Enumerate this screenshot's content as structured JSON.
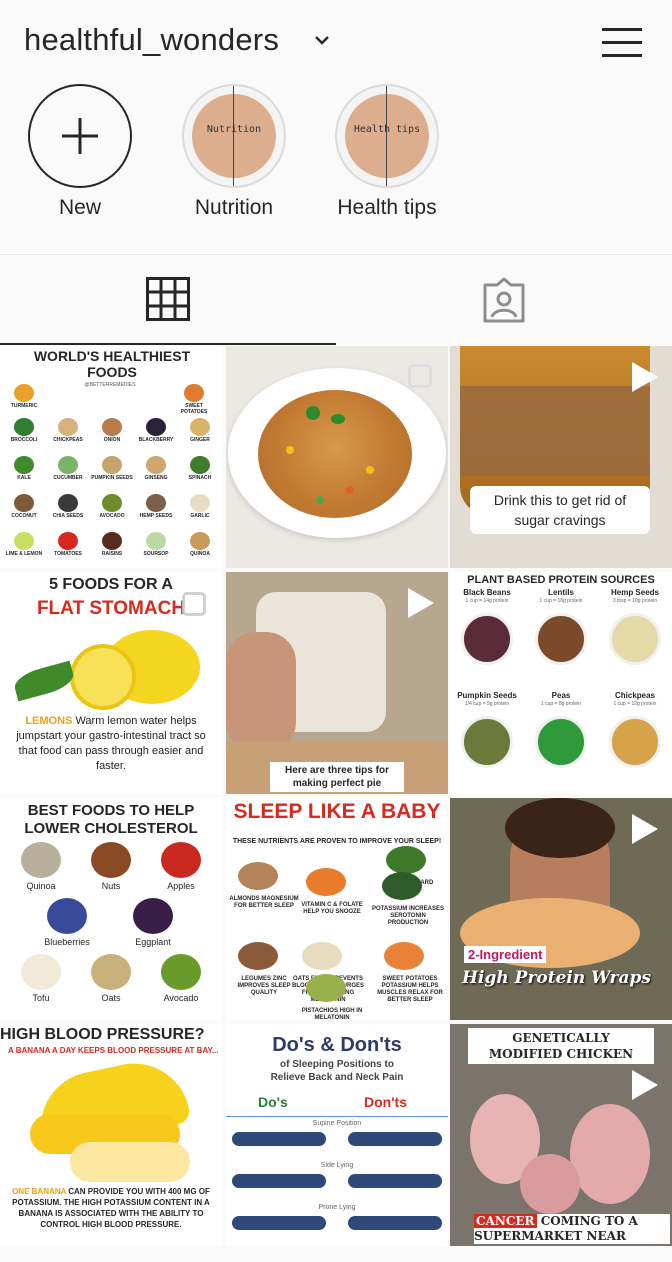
{
  "header": {
    "username": "healthful_wonders"
  },
  "highlights": [
    {
      "label": "New"
    },
    {
      "label": "Nutrition",
      "cover_text": "Nutrition"
    },
    {
      "label": "Health tips",
      "cover_text": "Health tips"
    }
  ],
  "tabs": [
    {
      "icon": "grid-icon"
    },
    {
      "icon": "tagged-icon"
    }
  ],
  "posts": {
    "p1": {
      "title": "WORLD'S HEALTHIEST FOODS",
      "handle": "@BETTERREMEDIES",
      "foods": [
        "TURMERIC",
        "SWEET POTATOES",
        "BROCCOLI",
        "CHICKPEAS",
        "ONION",
        "BLACKBERRY",
        "GINGER",
        "KALE",
        "CUCUMBER",
        "PUMPKIN SEEDS",
        "GINSENG",
        "SPINACH",
        "COCONUT",
        "CHIA SEEDS",
        "AVOCADO",
        "HEMP SEEDS",
        "GARLIC",
        "LIME & LEMON",
        "TOMATOES",
        "RAISINS",
        "SOURSOP",
        "QUINOA"
      ]
    },
    "p3": {
      "caption_line1": "Drink this to get rid of",
      "caption_line2": "sugar cravings"
    },
    "p4": {
      "title1": "5 FOODS FOR A",
      "title2": "FLAT STOMACH",
      "highlight": "LEMONS",
      "body": "Warm lemon water helps jumpstart your gastro-intestinal tract so that food can pass through easier and faster."
    },
    "p5": {
      "caption_line1": "Here are three tips for",
      "caption_line2": "making perfect pie"
    },
    "p6": {
      "title": "PLANT BASED PROTEIN SOURCES",
      "items": [
        {
          "name": "Black Beans",
          "amount": "1 cup = 14g protein"
        },
        {
          "name": "Lentils",
          "amount": "1 cup = 18g protein"
        },
        {
          "name": "Hemp Seeds",
          "amount": "3 tbsp = 10g protein"
        },
        {
          "name": "Pumpkin Seeds",
          "amount": "1/4 cup = 9g protein"
        },
        {
          "name": "Peas",
          "amount": "1 cup = 8g protein"
        },
        {
          "name": "Chickpeas",
          "amount": "1 cup = 12g protein"
        }
      ]
    },
    "p7": {
      "title1": "BEST FOODS TO HELP",
      "title2": "LOWER CHOLESTEROL",
      "foods": [
        "Quinoa",
        "Nuts",
        "Apples",
        "Blueberries",
        "Eggplant",
        "Tofu",
        "Oats",
        "Avocado"
      ]
    },
    "p8": {
      "title": "SLEEP LIKE A BABY",
      "subtitle": "THESE NUTRIENTS ARE PROVEN TO IMPROVE YOUR SLEEP!",
      "notes": [
        "ALMONDS MAGNESIUM FOR BETTER SLEEP",
        "VITAMIN C & FOLATE HELP YOU SNOOZE",
        "SWISS CHARD",
        "POTASSIUM INCREASES SEROTONIN PRODUCTION",
        "LEGUMES ZINC IMPROVES SLEEP QUALITY",
        "OATS FIBER PREVENTS BLOOD SUGAR SURGES FROM LOWERING MELATONIN",
        "SWEET POTATOES POTASSIUM HELPS MUSCLES RELAX FOR BETTER SLEEP",
        "PISTACHIOS HIGH IN MELATONIN"
      ]
    },
    "p9": {
      "tag": "2-Ingredient",
      "caption": "High Protein Wraps"
    },
    "p10": {
      "title": "HIGH BLOOD PRESSURE?",
      "subtitle": "A BANANA A DAY KEEPS BLOOD PRESSURE AT BAY...",
      "body_highlight": "ONE BANANA",
      "body": "CAN PROVIDE YOU WITH 400 MG OF POTASSIUM. THE HIGH POTASSIUM CONTENT IN A BANANA IS ASSOCIATED WITH THE ABILITY TO CONTROL HIGH BLOOD PRESSURE."
    },
    "p11": {
      "title": "Do's & Don'ts",
      "subtitle": "of Sleeping Positions to Relieve Back and Neck Pain",
      "dos": "Do's",
      "donts": "Don'ts",
      "positions": [
        "Supine Position",
        "Side Lying",
        "Prone Lying"
      ]
    },
    "p12": {
      "title1": "GENETICALLY",
      "title2": "MODIFIED CHICKEN",
      "tag": "CANCER",
      "caption_line1": "COMING TO A",
      "caption_line2": "SUPERMARKET NEAR"
    }
  },
  "colors": {
    "accent_red": "#d62a1f",
    "lemon_label": "#e8a11a",
    "cover_tan": "#dcae8e"
  }
}
